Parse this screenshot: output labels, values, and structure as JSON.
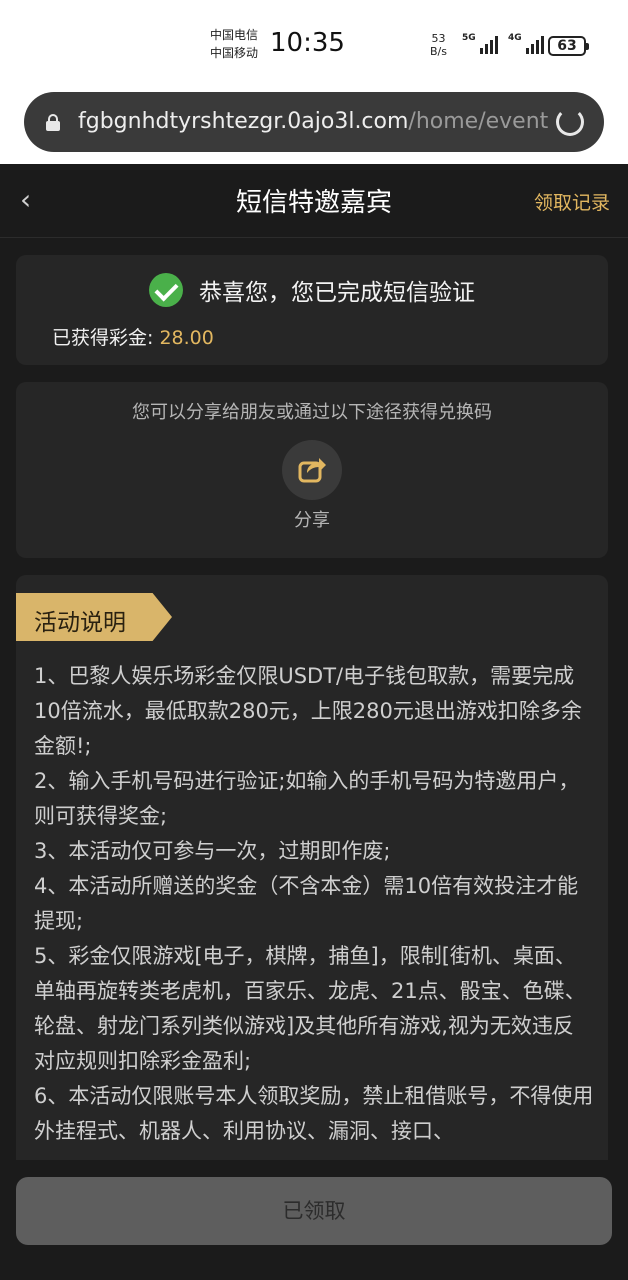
{
  "status_bar": {
    "carrier1": "中国电信",
    "carrier2": "中国移动",
    "time": "10:35",
    "net_speed_value": "53",
    "net_speed_unit": "B/s",
    "signal1_label": "5G",
    "signal2_label": "4G",
    "battery": "63"
  },
  "browser": {
    "url_host": "fgbgnhdtyrshtezgr.0ajo3l.com",
    "url_path": "/home/event"
  },
  "header": {
    "title": "短信特邀嘉宾",
    "records_link": "领取记录"
  },
  "verification": {
    "message": "恭喜您，您已完成短信验证",
    "bonus_label": "已获得彩金:",
    "bonus_amount": "28.00"
  },
  "share": {
    "tip": "您可以分享给朋友或通过以下途径获得兑换码",
    "label": "分享"
  },
  "rules": {
    "heading": "活动说明",
    "items": [
      "1、巴黎人娱乐场彩金仅限USDT/电子钱包取款，需要完成10倍流水，最低取款280元，上限280元退出游戏扣除多余金额!;",
      "2、输入手机号码进行验证;如输入的手机号码为特邀用户，则可获得奖金;",
      "3、本活动仅可参与一次，过期即作废;",
      "4、本活动所赠送的奖金（不含本金）需10倍有效投注才能提现;",
      "5、彩金仅限游戏[电子，棋牌，捕鱼]，限制[街机、桌面、单轴再旋转类老虎机，百家乐、龙虎、21点、骰宝、色碟、轮盘、射龙门系列类似游戏]及其他所有游戏,视为无效违反对应规则扣除彩金盈利;",
      "6、本活动仅限账号本人领取奖励，禁止租借账号，不得使用外挂程式、机器人、利用协议、漏洞、接口、"
    ]
  },
  "footer": {
    "claimed_button": "已领取"
  },
  "colors": {
    "background": "#1b1b1b",
    "card": "#262626",
    "accent_gold": "#e2b760",
    "success_green": "#4ab04a",
    "button_disabled": "#5e5e5e"
  },
  "icons": [
    "lock-icon",
    "reload-icon",
    "back-icon",
    "check-icon",
    "share-icon"
  ]
}
